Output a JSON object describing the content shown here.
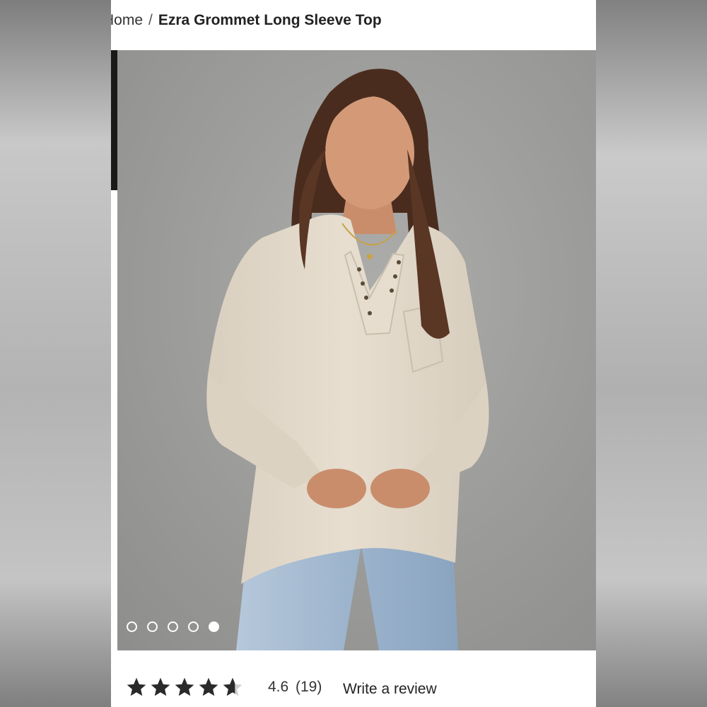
{
  "breadcrumb": {
    "home_label": "Home",
    "separator": "/",
    "current": "Ezra Grommet Long Sleeve Top"
  },
  "gallery": {
    "image_alt": "Model wearing beige Ezra Grommet Long Sleeve Top with light blue jeans",
    "slide_count": 5,
    "active_index": 4
  },
  "rating": {
    "score": "4.6",
    "count": "(19)",
    "stars_value": 4.6,
    "write_review_label": "Write a review"
  },
  "colors": {
    "top_fabric": "#e2d8c8",
    "denim": "#9fb6cf",
    "background": "#9a9a98"
  }
}
